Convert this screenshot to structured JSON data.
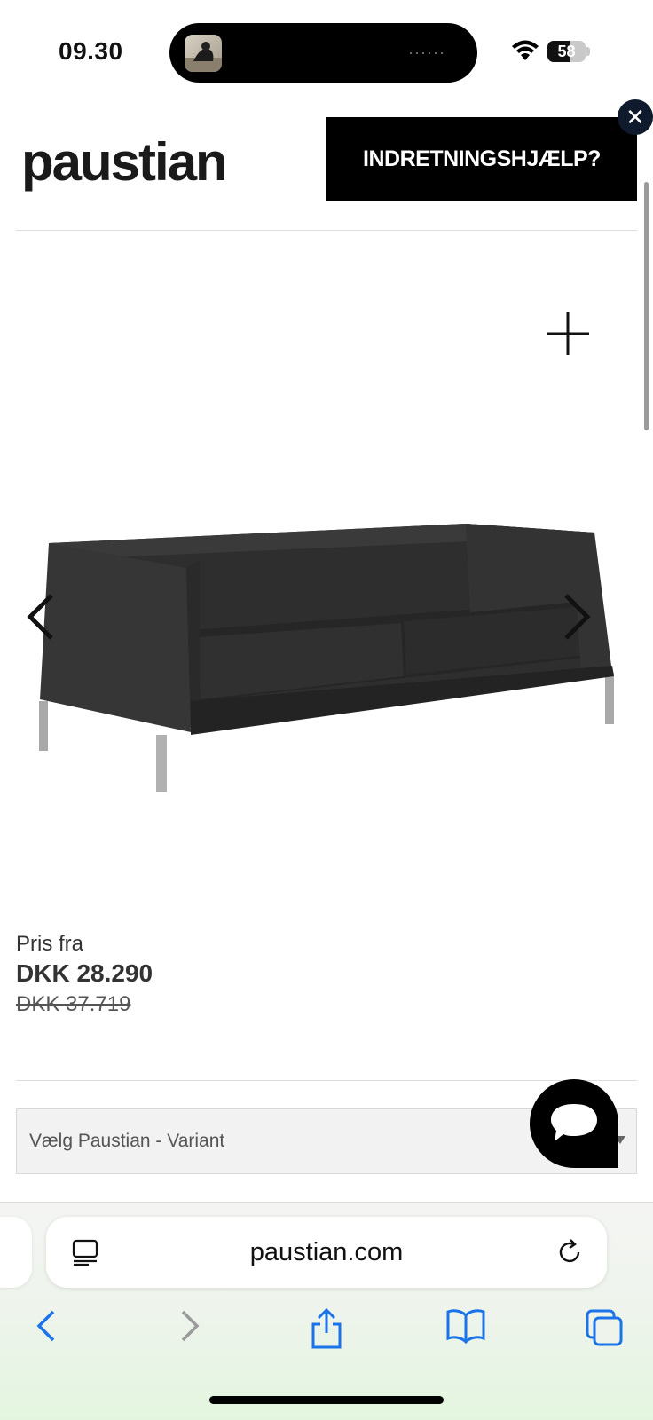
{
  "status_bar": {
    "time": "09.30",
    "battery": "58",
    "battery_level": 0.58,
    "island_dots": "······"
  },
  "header": {
    "logo": "paustian",
    "help_button": "INDRETNINGSHJÆLP?",
    "close_icon": "close-icon"
  },
  "gallery": {
    "product": "sofa",
    "zoom_icon": "plus-icon",
    "prev_icon": "chevron-left-icon",
    "next_icon": "chevron-right-icon"
  },
  "price": {
    "label": "Pris fra",
    "current": "DKK 28.290",
    "original": "DKK 37.719"
  },
  "variant_select": {
    "placeholder": "Vælg Paustian - Variant"
  },
  "chat": {
    "icon": "chat-bubble-icon"
  },
  "browser": {
    "url": "paustian.com",
    "accent": "#1a73e8"
  }
}
